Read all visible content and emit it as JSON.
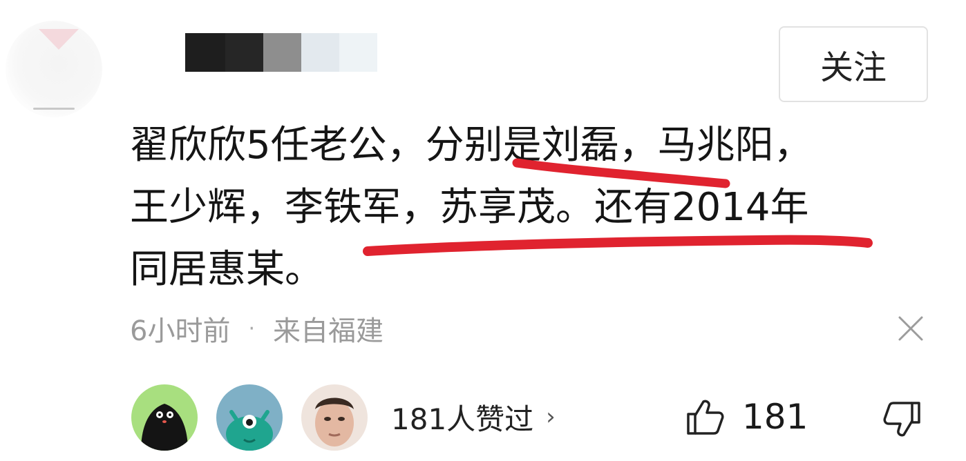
{
  "header": {
    "follow_label": "关注"
  },
  "comment": {
    "lines": [
      "翟欣欣5任老公，分别是刘磊，马兆阳，",
      "王少辉，李铁军，苏享茂。还有2014年",
      "同居惠某。"
    ]
  },
  "meta": {
    "time": "6小时前",
    "separator": "·",
    "location": "来自福建"
  },
  "likes": {
    "summary_label": "181人赞过",
    "chevron": "›",
    "count": "181"
  },
  "icons": {
    "close": "close-icon",
    "like": "thumbs-up-icon",
    "dislike": "thumbs-down-icon",
    "chevron": "chevron-right-icon"
  },
  "colors": {
    "annotation_red": "#e0232f",
    "meta_gray": "#9a9a9a",
    "text_dark": "#151515"
  }
}
